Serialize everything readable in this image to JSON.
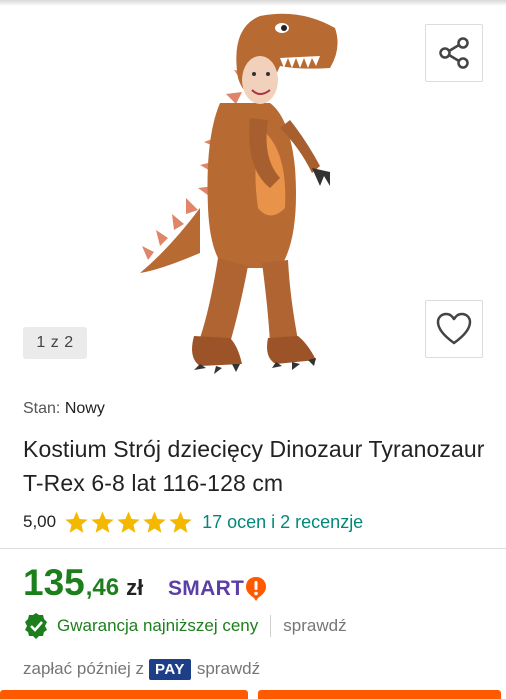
{
  "gallery": {
    "counter": "1 z 2",
    "image_alt": "dinosaur costume",
    "share_icon": "share-icon",
    "favorite_icon": "heart-icon"
  },
  "product": {
    "condition_label": "Stan:",
    "condition_value": "Nowy",
    "title": "Kostium Strój dziecięcy Dinozaur Tyranozaur T-Rex 6-8 lat 116-128 cm",
    "rating_value": "5,00",
    "stars": 5,
    "reviews_text": "17 ocen i 2 recenzje"
  },
  "price": {
    "integer": "135",
    "decimal": ",46",
    "currency": "zł",
    "smart_label": "SMART"
  },
  "guarantee": {
    "text": "Gwarancja najniższej ceny",
    "check": "sprawdź"
  },
  "paylater": {
    "text": "zapłać później z",
    "badge": "PAY",
    "check": "sprawdź"
  },
  "colors": {
    "accent_green": "#1c7f1c",
    "link_teal": "#00897b",
    "star": "#f5b800",
    "smart_purple": "#5b3fa5",
    "smart_orange": "#ff5a00",
    "cta_orange": "#ff5a00"
  }
}
